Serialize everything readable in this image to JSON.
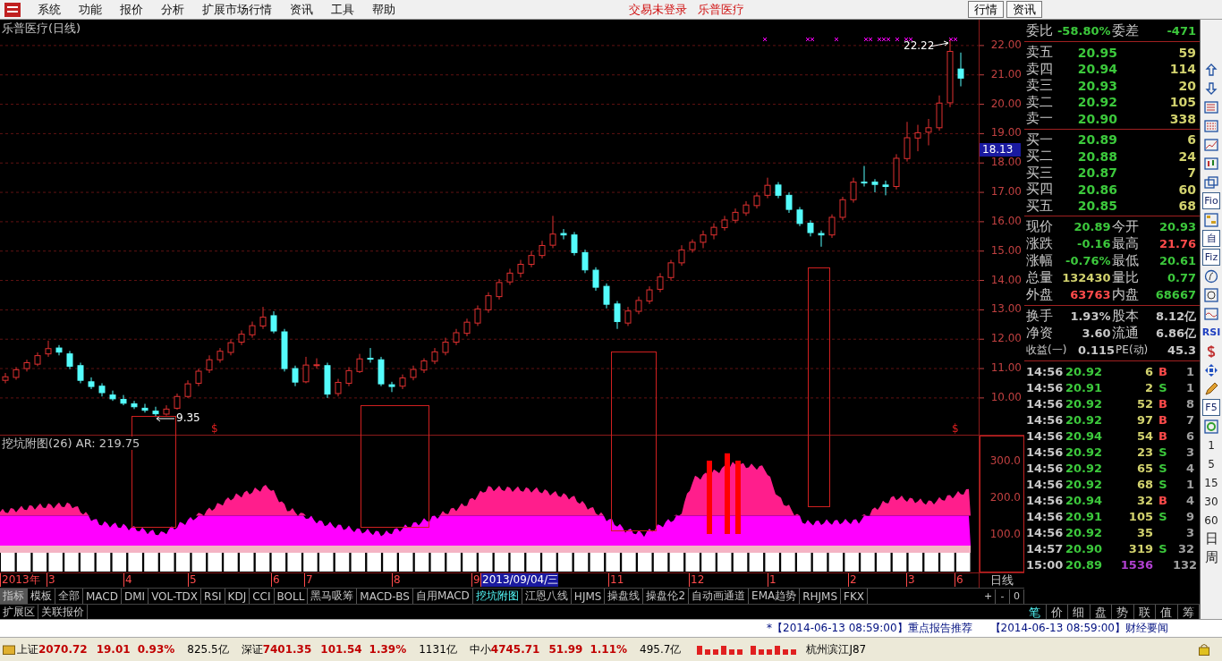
{
  "menu": [
    "系统",
    "功能",
    "报价",
    "分析",
    "扩展市场行情",
    "资讯",
    "工具",
    "帮助"
  ],
  "notices": [
    "交易未登录",
    "乐普医疗"
  ],
  "top_buttons": [
    "行情",
    "资讯"
  ],
  "chart": {
    "title": "乐普医疗(日线)",
    "high_label": "22.22",
    "low_label": "9.35",
    "signals": [
      "$",
      "$"
    ],
    "chart_data": {
      "type": "candlestick",
      "grid": true,
      "ylim": [
        3.54,
        22.88
      ],
      "yticks": [
        {
          "value": 22,
          "label": "22.00"
        },
        {
          "value": 21,
          "label": "21.00"
        },
        {
          "value": 20,
          "label": "20.00"
        },
        {
          "value": 19,
          "label": "19.00"
        },
        {
          "value": 18,
          "label": "18.00"
        },
        {
          "value": 17,
          "label": "17.00"
        },
        {
          "value": 16,
          "label": "16.00"
        },
        {
          "value": 15,
          "label": "15.00"
        },
        {
          "value": 14,
          "label": "14.00"
        },
        {
          "value": 13,
          "label": "13.00"
        },
        {
          "value": 12,
          "label": "12.00"
        },
        {
          "value": 11,
          "label": "11.00"
        },
        {
          "value": 10,
          "label": "10.00"
        }
      ],
      "ohlc": [
        [
          10.6,
          10.85,
          10.5,
          10.72
        ],
        [
          10.7,
          11.05,
          10.62,
          10.96
        ],
        [
          11.0,
          11.3,
          10.9,
          11.2
        ],
        [
          11.15,
          11.55,
          11.08,
          11.44
        ],
        [
          11.5,
          11.95,
          11.4,
          11.68
        ],
        [
          11.7,
          11.8,
          11.45,
          11.56
        ],
        [
          11.5,
          11.6,
          10.98,
          11.08
        ],
        [
          11.1,
          11.2,
          10.5,
          10.6
        ],
        [
          10.55,
          10.7,
          10.3,
          10.39
        ],
        [
          10.4,
          10.5,
          10.05,
          10.18
        ],
        [
          10.1,
          10.25,
          9.9,
          9.97
        ],
        [
          9.95,
          10.1,
          9.75,
          9.82
        ],
        [
          9.8,
          9.9,
          9.62,
          9.7
        ],
        [
          9.65,
          9.8,
          9.5,
          9.58
        ],
        [
          9.55,
          9.7,
          9.35,
          9.46
        ],
        [
          9.45,
          9.75,
          9.4,
          9.62
        ],
        [
          9.65,
          10.15,
          9.6,
          10.05
        ],
        [
          10.05,
          10.6,
          10.0,
          10.48
        ],
        [
          10.5,
          11.0,
          10.4,
          10.91
        ],
        [
          10.95,
          11.45,
          10.85,
          11.3
        ],
        [
          11.3,
          11.7,
          11.2,
          11.59
        ],
        [
          11.55,
          12.0,
          11.45,
          11.88
        ],
        [
          11.9,
          12.3,
          11.8,
          12.17
        ],
        [
          12.15,
          12.6,
          12.05,
          12.46
        ],
        [
          12.45,
          13.1,
          12.35,
          12.75
        ],
        [
          12.8,
          12.95,
          12.2,
          12.28
        ],
        [
          12.25,
          12.35,
          10.9,
          11.0
        ],
        [
          11.0,
          11.1,
          10.4,
          10.54
        ],
        [
          10.55,
          11.4,
          10.5,
          11.12
        ],
        [
          11.1,
          11.35,
          11.0,
          11.13
        ],
        [
          11.1,
          11.2,
          10.0,
          10.13
        ],
        [
          10.15,
          10.65,
          10.05,
          10.53
        ],
        [
          10.5,
          11.05,
          10.4,
          10.93
        ],
        [
          10.9,
          11.5,
          10.85,
          11.33
        ],
        [
          11.35,
          11.7,
          11.2,
          11.32
        ],
        [
          11.3,
          11.4,
          10.4,
          10.48
        ],
        [
          10.45,
          10.55,
          10.2,
          10.39
        ],
        [
          10.4,
          10.8,
          10.3,
          10.68
        ],
        [
          10.7,
          11.1,
          10.6,
          10.97
        ],
        [
          10.95,
          11.35,
          10.85,
          11.26
        ],
        [
          11.25,
          11.7,
          11.15,
          11.57
        ],
        [
          11.55,
          12.05,
          11.45,
          11.9
        ],
        [
          11.9,
          12.35,
          11.8,
          12.22
        ],
        [
          12.2,
          12.7,
          12.1,
          12.58
        ],
        [
          12.55,
          13.15,
          12.45,
          13.03
        ],
        [
          13.0,
          13.6,
          12.9,
          13.48
        ],
        [
          13.45,
          14.05,
          13.35,
          13.93
        ],
        [
          13.95,
          14.4,
          13.85,
          14.25
        ],
        [
          14.25,
          14.7,
          14.1,
          14.55
        ],
        [
          14.55,
          15.0,
          14.45,
          14.85
        ],
        [
          14.85,
          15.35,
          14.75,
          15.19
        ],
        [
          15.2,
          16.2,
          15.1,
          15.58
        ],
        [
          15.6,
          15.75,
          15.4,
          15.55
        ],
        [
          15.55,
          15.65,
          14.85,
          14.95
        ],
        [
          14.95,
          15.05,
          14.25,
          14.36
        ],
        [
          14.35,
          14.45,
          13.65,
          13.77
        ],
        [
          13.8,
          13.9,
          13.05,
          13.19
        ],
        [
          13.2,
          13.3,
          12.35,
          12.6
        ],
        [
          12.55,
          13.1,
          12.45,
          12.96
        ],
        [
          12.95,
          13.45,
          12.85,
          13.32
        ],
        [
          13.3,
          13.8,
          13.2,
          13.68
        ],
        [
          13.7,
          14.25,
          13.6,
          14.12
        ],
        [
          14.1,
          14.7,
          14.0,
          14.6
        ],
        [
          14.6,
          15.2,
          14.5,
          15.04
        ],
        [
          15.05,
          15.4,
          14.95,
          15.3
        ],
        [
          15.3,
          15.7,
          15.1,
          15.55
        ],
        [
          15.55,
          15.95,
          15.4,
          15.81
        ],
        [
          15.8,
          16.2,
          15.7,
          16.06
        ],
        [
          16.05,
          16.45,
          15.95,
          16.32
        ],
        [
          16.3,
          16.7,
          16.2,
          16.57
        ],
        [
          16.55,
          17.0,
          16.45,
          16.88
        ],
        [
          16.9,
          17.5,
          16.8,
          17.24
        ],
        [
          17.25,
          17.35,
          16.8,
          16.9
        ],
        [
          16.9,
          17.0,
          16.3,
          16.42
        ],
        [
          16.4,
          16.5,
          15.85,
          15.94
        ],
        [
          15.95,
          16.05,
          15.5,
          15.63
        ],
        [
          15.6,
          15.7,
          15.15,
          15.55
        ],
        [
          15.55,
          16.25,
          15.45,
          16.15
        ],
        [
          16.15,
          16.85,
          16.05,
          16.75
        ],
        [
          16.75,
          17.5,
          16.65,
          17.35
        ],
        [
          17.35,
          17.9,
          17.2,
          17.34
        ],
        [
          17.35,
          17.45,
          17.0,
          17.27
        ],
        [
          17.25,
          17.4,
          16.9,
          17.2
        ],
        [
          17.2,
          18.3,
          17.1,
          18.16
        ],
        [
          18.15,
          19.4,
          18.05,
          18.86
        ],
        [
          18.85,
          19.3,
          18.4,
          19.03
        ],
        [
          19.05,
          19.5,
          18.6,
          19.2
        ],
        [
          19.2,
          20.3,
          19.1,
          20.04
        ],
        [
          20.05,
          22.22,
          19.9,
          21.8
        ],
        [
          21.2,
          21.76,
          20.61,
          20.89
        ]
      ]
    },
    "cursor_price": "18.13",
    "indicator_title": "挖坑附图(26) AR: 219.75",
    "indicator_axis": [
      "300.0",
      "200.0",
      "100.0"
    ],
    "period": "日线",
    "zoom_buttons": [
      "+",
      "-",
      "0"
    ],
    "dates": [
      {
        "label": "2013年",
        "selected": false
      },
      {
        "label": "3",
        "selected": false
      },
      {
        "label": "4",
        "selected": false
      },
      {
        "label": "5",
        "selected": false
      },
      {
        "label": "6",
        "selected": false
      },
      {
        "label": "7",
        "selected": false
      },
      {
        "label": "8",
        "selected": false
      },
      {
        "label": "9",
        "selected": false
      },
      {
        "label": "2013/09/04/三",
        "selected": true
      },
      {
        "label": "11",
        "selected": false
      },
      {
        "label": "12",
        "selected": false
      },
      {
        "label": "1",
        "selected": false
      },
      {
        "label": "2",
        "selected": false
      },
      {
        "label": "3",
        "selected": false
      },
      {
        "label": "6",
        "selected": false
      }
    ]
  },
  "indicator_tabs": [
    {
      "label": "指标",
      "kind": "header",
      "selected": false
    },
    {
      "label": "模板",
      "kind": "tab",
      "selected": false
    },
    {
      "label": "全部",
      "kind": "tab",
      "selected": false
    },
    {
      "label": "MACD",
      "kind": "tab",
      "selected": false
    },
    {
      "label": "DMI",
      "kind": "tab",
      "selected": false
    },
    {
      "label": "VOL-TDX",
      "kind": "tab",
      "selected": false
    },
    {
      "label": "RSI",
      "kind": "tab",
      "selected": false
    },
    {
      "label": "KDJ",
      "kind": "tab",
      "selected": false
    },
    {
      "label": "CCI",
      "kind": "tab",
      "selected": false
    },
    {
      "label": "BOLL",
      "kind": "tab",
      "selected": false
    },
    {
      "label": "黑马吸筹",
      "kind": "tab",
      "selected": false
    },
    {
      "label": "MACD-BS",
      "kind": "tab",
      "selected": false
    },
    {
      "label": "自用MACD",
      "kind": "tab",
      "selected": false
    },
    {
      "label": "挖坑附图",
      "kind": "tab",
      "selected": true
    },
    {
      "label": "江恩八线",
      "kind": "tab",
      "selected": false
    },
    {
      "label": "HJMS",
      "kind": "tab",
      "selected": false
    },
    {
      "label": "操盘线",
      "kind": "tab",
      "selected": false
    },
    {
      "label": "操盘伦2",
      "kind": "tab",
      "selected": false
    },
    {
      "label": "自动画通道",
      "kind": "tab",
      "selected": false
    },
    {
      "label": "EMA趋势",
      "kind": "tab",
      "selected": false
    },
    {
      "label": "RHJMS",
      "kind": "tab",
      "selected": false
    },
    {
      "label": "FKX",
      "kind": "tab",
      "selected": false
    }
  ],
  "extension_tabs": [
    "扩展区",
    "关联报价"
  ],
  "quote": {
    "ratio": [
      {
        "label": "委比",
        "value": "-58.80%",
        "kind": "down"
      },
      {
        "label": "委差",
        "value": "-471",
        "kind": "down"
      }
    ],
    "sell": [
      {
        "label": "卖五",
        "price": "20.95",
        "volume": "59"
      },
      {
        "label": "卖四",
        "price": "20.94",
        "volume": "114"
      },
      {
        "label": "卖三",
        "price": "20.93",
        "volume": "20"
      },
      {
        "label": "卖二",
        "price": "20.92",
        "volume": "105"
      },
      {
        "label": "卖一",
        "price": "20.90",
        "volume": "338"
      }
    ],
    "buy": [
      {
        "label": "买一",
        "price": "20.89",
        "volume": "6"
      },
      {
        "label": "买二",
        "price": "20.88",
        "volume": "24"
      },
      {
        "label": "买三",
        "price": "20.87",
        "volume": "7"
      },
      {
        "label": "买四",
        "price": "20.86",
        "volume": "60"
      },
      {
        "label": "买五",
        "price": "20.85",
        "volume": "68"
      }
    ],
    "stats": [
      [
        {
          "label": "现价",
          "value": "20.89",
          "kind": "down"
        },
        {
          "label": "今开",
          "value": "20.93",
          "kind": "down"
        }
      ],
      [
        {
          "label": "涨跌",
          "value": "-0.16",
          "kind": "down"
        },
        {
          "label": "最高",
          "value": "21.76",
          "kind": "up"
        }
      ],
      [
        {
          "label": "涨幅",
          "value": "-0.76%",
          "kind": "down"
        },
        {
          "label": "最低",
          "value": "20.61",
          "kind": "down"
        }
      ],
      [
        {
          "label": "总量",
          "value": "132430",
          "kind": "volume"
        },
        {
          "label": "量比",
          "value": "0.77",
          "kind": "down"
        }
      ],
      [
        {
          "label": "外盘",
          "value": "63763",
          "kind": "up"
        },
        {
          "label": "内盘",
          "value": "68667",
          "kind": "down"
        }
      ]
    ],
    "finance": [
      [
        {
          "label": "换手",
          "value": "1.93%",
          "kind": "plain"
        },
        {
          "label": "股本",
          "value": "8.12亿",
          "kind": "plain"
        }
      ],
      [
        {
          "label": "净资",
          "value": "3.60",
          "kind": "plain"
        },
        {
          "label": "流通",
          "value": "6.86亿",
          "kind": "plain"
        }
      ],
      [
        {
          "label": "收益(一)",
          "value": "0.115",
          "kind": "plain"
        },
        {
          "label": "PE(动)",
          "value": "45.3",
          "kind": "plain"
        }
      ]
    ]
  },
  "trades": [
    {
      "time": "14:56",
      "price": "20.92",
      "volume": "6",
      "side": "B",
      "kind": "buy",
      "count": "1"
    },
    {
      "time": "14:56",
      "price": "20.91",
      "volume": "2",
      "side": "S",
      "kind": "sell",
      "count": "1"
    },
    {
      "time": "14:56",
      "price": "20.92",
      "volume": "52",
      "side": "B",
      "kind": "buy",
      "count": "8"
    },
    {
      "time": "14:56",
      "price": "20.92",
      "volume": "97",
      "side": "B",
      "kind": "buy",
      "count": "7"
    },
    {
      "time": "14:56",
      "price": "20.94",
      "volume": "54",
      "side": "B",
      "kind": "buy",
      "count": "6"
    },
    {
      "time": "14:56",
      "price": "20.92",
      "volume": "23",
      "side": "S",
      "kind": "sell",
      "count": "3"
    },
    {
      "time": "14:56",
      "price": "20.92",
      "volume": "65",
      "side": "S",
      "kind": "sell",
      "count": "4"
    },
    {
      "time": "14:56",
      "price": "20.92",
      "volume": "68",
      "side": "S",
      "kind": "sell",
      "count": "1"
    },
    {
      "time": "14:56",
      "price": "20.94",
      "volume": "32",
      "side": "B",
      "kind": "buy",
      "count": "4"
    },
    {
      "time": "14:56",
      "price": "20.91",
      "volume": "105",
      "side": "S",
      "kind": "sell",
      "count": "9"
    },
    {
      "time": "14:56",
      "price": "20.92",
      "volume": "35",
      "kind": "neutral",
      "count": "3"
    },
    {
      "time": "14:57",
      "price": "20.90",
      "volume": "319",
      "side": "S",
      "kind": "sell",
      "count": "32"
    },
    {
      "time": "15:00",
      "price": "20.89",
      "volume": "1536",
      "kind": "closing",
      "count": "132"
    }
  ],
  "detail_tabs": [
    {
      "label": "笔",
      "selected": true
    },
    {
      "label": "价",
      "selected": false
    },
    {
      "label": "细",
      "selected": false
    },
    {
      "label": "盘",
      "selected": false
    },
    {
      "label": "势",
      "selected": false
    },
    {
      "label": "联",
      "selected": false
    },
    {
      "label": "值",
      "selected": false
    },
    {
      "label": "筹",
      "selected": false
    }
  ],
  "toolbar": [
    {
      "kind": "up-arrow"
    },
    {
      "kind": "down-arrow"
    },
    {
      "kind": "list"
    },
    {
      "kind": "grid"
    },
    {
      "kind": "line"
    },
    {
      "kind": "candles"
    },
    {
      "kind": "windows"
    },
    {
      "kind": "text",
      "label": "Fio"
    },
    {
      "kind": "tree"
    },
    {
      "kind": "text",
      "label": "自"
    },
    {
      "kind": "text",
      "label": "Fiz"
    },
    {
      "kind": "formula"
    },
    {
      "kind": "circle"
    },
    {
      "kind": "wave"
    },
    {
      "kind": "bold",
      "label": "RSI"
    },
    {
      "kind": "dollar"
    },
    {
      "kind": "move"
    },
    {
      "kind": "pencil"
    },
    {
      "kind": "text",
      "label": "F5"
    },
    {
      "kind": "refresh"
    },
    {
      "kind": "period",
      "label": "1"
    },
    {
      "kind": "period",
      "label": "5"
    },
    {
      "kind": "period",
      "label": "15"
    },
    {
      "kind": "period",
      "label": "30"
    },
    {
      "kind": "period",
      "label": "60"
    },
    {
      "kind": "big",
      "label": "日"
    },
    {
      "kind": "big",
      "label": "周"
    }
  ],
  "ticker": [
    "*【2014-06-13 08:59:00】重点报告推荐",
    "【2014-06-13 08:59:00】财经要闻"
  ],
  "status": [
    {
      "name": "上证",
      "index": "2070.72",
      "change": "19.01",
      "percent": "0.93%",
      "turnover": "825.5亿"
    },
    {
      "name": "深证",
      "index": "7401.35",
      "change": "101.54",
      "percent": "1.39%",
      "turnover": "1131亿"
    },
    {
      "name": "中小",
      "index": "4745.71",
      "change": "51.99",
      "percent": "1.11%",
      "turnover": "495.7亿"
    }
  ],
  "server": "杭州滨江J87"
}
